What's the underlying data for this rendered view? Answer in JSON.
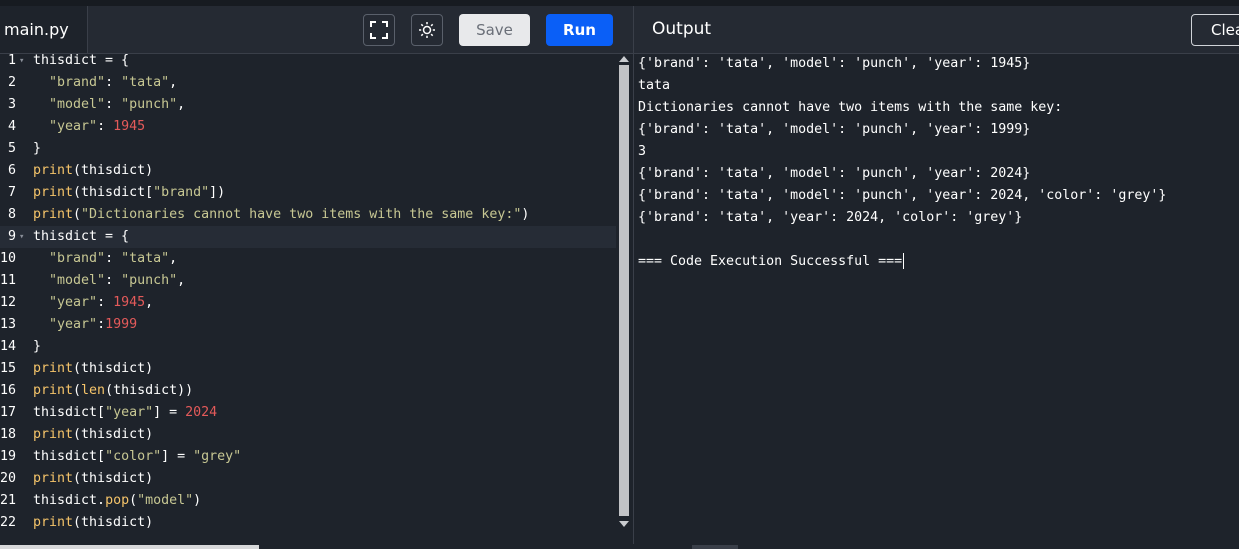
{
  "header": {
    "file_tab": "main.py",
    "save_label": "Save",
    "run_label": "Run",
    "output_title": "Output",
    "clear_label": "Clear",
    "icons": [
      "fullscreen-icon",
      "theme-toggle-icon"
    ]
  },
  "colors": {
    "run_button": "#0a5ff7",
    "keyword": "#f5c46a",
    "string": "#c7c793",
    "number": "#e45a5a"
  },
  "editor": {
    "lines": [
      {
        "num": "1",
        "text": "thisdict = {"
      },
      {
        "num": "2",
        "text": "  \"brand\": \"tata\","
      },
      {
        "num": "3",
        "text": "  \"model\": \"punch\","
      },
      {
        "num": "4",
        "text": "  \"year\": 1945"
      },
      {
        "num": "5",
        "text": "}"
      },
      {
        "num": "6",
        "text": "print(thisdict)"
      },
      {
        "num": "7",
        "text": "print(thisdict[\"brand\"])"
      },
      {
        "num": "8",
        "text": "print(\"Dictionaries cannot have two items with the same key:\")"
      },
      {
        "num": "9",
        "text": "thisdict = {"
      },
      {
        "num": "10",
        "text": "  \"brand\": \"tata\","
      },
      {
        "num": "11",
        "text": "  \"model\": \"punch\","
      },
      {
        "num": "12",
        "text": "  \"year\": 1945,"
      },
      {
        "num": "13",
        "text": "  \"year\":1999"
      },
      {
        "num": "14",
        "text": "}"
      },
      {
        "num": "15",
        "text": "print(thisdict)"
      },
      {
        "num": "16",
        "text": "print(len(thisdict))"
      },
      {
        "num": "17",
        "text": "thisdict[\"year\"] = 2024"
      },
      {
        "num": "18",
        "text": "print(thisdict)"
      },
      {
        "num": "19",
        "text": "thisdict[\"color\"] = \"grey\""
      },
      {
        "num": "20",
        "text": "print(thisdict)"
      },
      {
        "num": "21",
        "text": "thisdict.pop(\"model\")"
      },
      {
        "num": "22",
        "text": "print(thisdict)"
      }
    ]
  },
  "output": {
    "lines": [
      "{'brand': 'tata', 'model': 'punch', 'year': 1945}",
      "tata",
      "Dictionaries cannot have two items with the same key:",
      "{'brand': 'tata', 'model': 'punch', 'year': 1999}",
      "3",
      "{'brand': 'tata', 'model': 'punch', 'year': 2024}",
      "{'brand': 'tata', 'model': 'punch', 'year': 2024, 'color': 'grey'}",
      "{'brand': 'tata', 'year': 2024, 'color': 'grey'}",
      "",
      "=== Code Execution Successful ==="
    ]
  }
}
